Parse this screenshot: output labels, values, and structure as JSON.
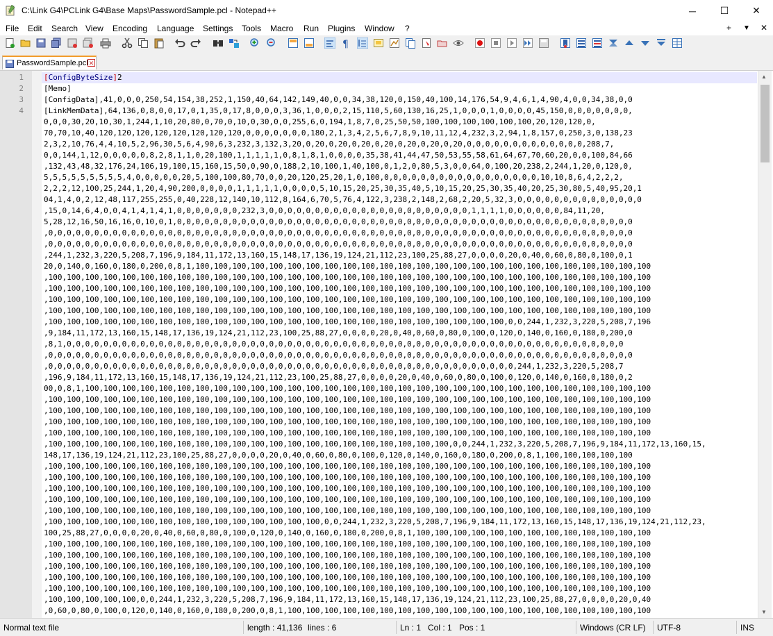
{
  "window": {
    "title": "C:\\Link G4\\PCLink G4\\Base Maps\\PasswordSample.pcl - Notepad++",
    "minimize": "─",
    "maximize": "☐",
    "close": "✕"
  },
  "menu": {
    "items": [
      "File",
      "Edit",
      "Search",
      "View",
      "Encoding",
      "Language",
      "Settings",
      "Tools",
      "Macro",
      "Run",
      "Plugins",
      "Window",
      "?"
    ],
    "right": [
      "+",
      "▼",
      "✕"
    ]
  },
  "toolbar": {
    "icons": [
      "new-file",
      "open-file",
      "save",
      "save-all",
      "close",
      "close-all",
      "print",
      "cut",
      "copy",
      "paste",
      "undo",
      "redo",
      "find",
      "replace",
      "zoom-in",
      "zoom-out",
      "sync-vertical",
      "sync-horizontal",
      "word-wrap",
      "show-all-chars",
      "indent-guide",
      "udl",
      "doc-map",
      "function-list",
      "folder-workspace",
      "monitoring",
      "start-recording",
      "stop-recording",
      "playback",
      "run-macro-multiple",
      "save-macro",
      "bookmark",
      "doc-list",
      "doc-switcher",
      "fold-all",
      "up",
      "down",
      "unfold",
      "panel"
    ]
  },
  "tab": {
    "label": "PasswordSample.pcl",
    "close": "✕"
  },
  "editor": {
    "line_numbers": [
      "1",
      "2",
      "3",
      "4"
    ],
    "lines": [
      {
        "bracket_open": "[",
        "section": "ConfigByteSize",
        "bracket_close": "]",
        "rest": "2"
      },
      {
        "bracket_open": "",
        "section": "",
        "bracket_close": "",
        "rest": "[Memo]"
      },
      {
        "bracket_open": "",
        "section": "",
        "bracket_close": "",
        "rest": "[ConfigData],41,0,0,0,250,54,154,38,252,1,150,40,64,142,149,40,0,0,34,38,120,0,150,40,100,14,176,54,9,4,6,1,4,90,4,0,0,34,38,0,0"
      }
    ],
    "wrap_lines": [
      "[LinkMemData],64,136,0,8,0,0,17,0,1,35,0,17,8,0,0,0,3,36,1,0,0,0,2,15,110,5,60,130,16,25,1,0,0,0,1,0,0,0,0,45,150,0,0,0,0,0,0,0,",
      "0,0,0,30,20,10,30,1,244,1,10,20,80,0,70,0,10,0,30,0,0,255,6,0,194,1,8,7,0,25,50,50,100,100,100,100,100,100,20,120,120,0,",
      "70,70,10,40,120,120,120,120,120,120,120,120,0,0,0,0,0,0,0,180,2,1,3,4,2,5,6,7,8,9,10,11,12,4,232,3,2,94,1,8,157,0,250,3,0,138,23",
      "2,3,2,10,76,4,4,10,5,2,96,30,5,6,4,90,6,3,232,3,132,3,20,0,20,0,20,0,20,0,20,0,20,0,20,0,20,0,0,0,0,0,0,0,0,0,0,0,0,0,208,7,",
      "0,0,144,1,12,0,0,0,0,0,8,2,8,1,1,0,20,100,1,1,1,1,1,0,8,1,8,1,0,0,0,0,35,38,41,44,47,50,53,55,58,61,64,67,70,60,20,0,0,100,84,66",
      ",132,43,48,32,176,24,106,19,100,15,160,15,50,0,90,0,188,2,10,100,1,40,100,0,1,2,0,80,5,3,0,0,64,0,100,20,238,2,244,1,20,0,120,0,",
      "5,5,5,5,5,5,5,5,5,4,0,0,0,0,0,20,5,100,100,80,70,0,0,20,120,25,20,1,0,100,0,0,0,0,0,0,0,0,0,0,0,0,0,0,0,0,0,10,10,8,6,4,2,2,2,",
      "2,2,2,12,100,25,244,1,20,4,90,200,0,0,0,0,1,1,1,1,1,0,0,0,0,5,10,15,20,25,30,35,40,5,10,15,20,25,30,35,40,20,25,30,80,5,40,95,20,1",
      "04,1,4,0,2,12,48,117,255,255,0,40,228,12,140,10,112,8,164,6,70,5,76,4,122,3,238,2,148,2,68,2,20,5,32,3,0,0,0,0,0,0,0,0,0,0,0,0,0,0",
      ",15,0,14,6,4,0,0,4,1,4,1,4,1,0,0,0,0,0,0,0,232,3,0,0,0,0,0,0,0,0,0,0,0,0,0,0,0,0,0,0,0,0,0,0,1,1,1,1,0,0,0,0,0,0,84,11,20,",
      "5,28,12,16,50,16,16,0,10,0,1,0,0,0,0,0,0,0,0,0,0,0,0,0,0,0,0,0,0,0,0,0,0,0,0,0,0,0,0,0,0,0,0,0,0,0,0,0,0,0,0,0,0,0,0,0,0,0,0,0,0",
      ",0,0,0,0,0,0,0,0,0,0,0,0,0,0,0,0,0,0,0,0,0,0,0,0,0,0,0,0,0,0,0,0,0,0,0,0,0,0,0,0,0,0,0,0,0,0,0,0,0,0,0,0,0,0,0,0,0,0,0,0,0,0,0,0",
      ",0,0,0,0,0,0,0,0,0,0,0,0,0,0,0,0,0,0,0,0,0,0,0,0,0,0,0,0,0,0,0,0,0,0,0,0,0,0,0,0,0,0,0,0,0,0,0,0,0,0,0,0,0,0,0,0,0,0,0,0,0,0,0,0",
      ",244,1,232,3,220,5,208,7,196,9,184,11,172,13,160,15,148,17,136,19,124,21,112,23,100,25,88,27,0,0,0,0,20,0,40,0,60,0,80,0,100,0,1",
      "20,0,140,0,160,0,180,0,200,0,8,1,100,100,100,100,100,100,100,100,100,100,100,100,100,100,100,100,100,100,100,100,100,100,100,100,100",
      ",100,100,100,100,100,100,100,100,100,100,100,100,100,100,100,100,100,100,100,100,100,100,100,100,100,100,100,100,100,100,100,100,100",
      ",100,100,100,100,100,100,100,100,100,100,100,100,100,100,100,100,100,100,100,100,100,100,100,100,100,100,100,100,100,100,100,100,100",
      ",100,100,100,100,100,100,100,100,100,100,100,100,100,100,100,100,100,100,100,100,100,100,100,100,100,100,100,100,100,100,100,100,100",
      ",100,100,100,100,100,100,100,100,100,100,100,100,100,100,100,100,100,100,100,100,100,100,100,100,100,100,100,100,100,100,100,100,100",
      ",100,100,100,100,100,100,100,100,100,100,100,100,100,100,100,100,100,100,100,100,100,100,100,100,100,0,0,244,1,232,3,220,5,208,7,196",
      ",9,184,11,172,13,160,15,148,17,136,19,124,21,112,23,100,25,88,27,0,0,0,0,20,0,40,0,60,0,80,0,100,0,120,0,140,0,160,0,180,0,200,0",
      ",8,1,0,0,0,0,0,0,0,0,0,0,0,0,0,0,0,0,0,0,0,0,0,0,0,0,0,0,0,0,0,0,0,0,0,0,0,0,0,0,0,0,0,0,0,0,0,0,0,0,0,0,0,0,0,0,0,0,0,0,0,0,0",
      ",0,0,0,0,0,0,0,0,0,0,0,0,0,0,0,0,0,0,0,0,0,0,0,0,0,0,0,0,0,0,0,0,0,0,0,0,0,0,0,0,0,0,0,0,0,0,0,0,0,0,0,0,0,0,0,0,0,0,0,0,0,0,0,0",
      ",0,0,0,0,0,0,0,0,0,0,0,0,0,0,0,0,0,0,0,0,0,0,0,0,0,0,0,0,0,0,0,0,0,0,0,0,0,0,0,0,0,0,0,0,0,0,0,0,0,0,0,244,1,232,3,220,5,208,7",
      ",196,9,184,11,172,13,160,15,148,17,136,19,124,21,112,23,100,25,88,27,0,0,0,0,20,0,40,0,60,0,80,0,100,0,120,0,140,0,160,0,180,0,2",
      "00,0,8,1,100,100,100,100,100,100,100,100,100,100,100,100,100,100,100,100,100,100,100,100,100,100,100,100,100,100,100,100,100,100,100",
      ",100,100,100,100,100,100,100,100,100,100,100,100,100,100,100,100,100,100,100,100,100,100,100,100,100,100,100,100,100,100,100,100,100",
      ",100,100,100,100,100,100,100,100,100,100,100,100,100,100,100,100,100,100,100,100,100,100,100,100,100,100,100,100,100,100,100,100,100",
      ",100,100,100,100,100,100,100,100,100,100,100,100,100,100,100,100,100,100,100,100,100,100,100,100,100,100,100,100,100,100,100,100,100",
      ",100,100,100,100,100,100,100,100,100,100,100,100,100,100,100,100,100,100,100,100,100,100,100,100,100,100,100,100,100,100,100,100,100",
      ",100,100,100,100,100,100,100,100,100,100,100,100,100,100,100,100,100,100,100,100,100,100,0,0,244,1,232,3,220,5,208,7,196,9,184,11,172,13,160,15,",
      "148,17,136,19,124,21,112,23,100,25,88,27,0,0,0,0,20,0,40,0,60,0,80,0,100,0,120,0,140,0,160,0,180,0,200,0,8,1,100,100,100,100,100",
      ",100,100,100,100,100,100,100,100,100,100,100,100,100,100,100,100,100,100,100,100,100,100,100,100,100,100,100,100,100,100,100,100,100",
      ",100,100,100,100,100,100,100,100,100,100,100,100,100,100,100,100,100,100,100,100,100,100,100,100,100,100,100,100,100,100,100,100,100",
      ",100,100,100,100,100,100,100,100,100,100,100,100,100,100,100,100,100,100,100,100,100,100,100,100,100,100,100,100,100,100,100,100,100",
      ",100,100,100,100,100,100,100,100,100,100,100,100,100,100,100,100,100,100,100,100,100,100,100,100,100,100,100,100,100,100,100,100,100",
      ",100,100,100,100,100,100,100,100,100,100,100,100,100,100,100,100,100,100,100,100,100,100,100,100,100,100,100,100,100,100,100,100,100",
      ",100,100,100,100,100,100,100,100,100,100,100,100,100,100,100,0,0,244,1,232,3,220,5,208,7,196,9,184,11,172,13,160,15,148,17,136,19,124,21,112,23,",
      "100,25,88,27,0,0,0,0,20,0,40,0,60,0,80,0,100,0,120,0,140,0,160,0,180,0,200,0,8,1,100,100,100,100,100,100,100,100,100,100,100,100,100",
      ",100,100,100,100,100,100,100,100,100,100,100,100,100,100,100,100,100,100,100,100,100,100,100,100,100,100,100,100,100,100,100,100,100",
      ",100,100,100,100,100,100,100,100,100,100,100,100,100,100,100,100,100,100,100,100,100,100,100,100,100,100,100,100,100,100,100,100,100",
      ",100,100,100,100,100,100,100,100,100,100,100,100,100,100,100,100,100,100,100,100,100,100,100,100,100,100,100,100,100,100,100,100,100",
      ",100,100,100,100,100,100,100,100,100,100,100,100,100,100,100,100,100,100,100,100,100,100,100,100,100,100,100,100,100,100,100,100,100",
      ",100,100,100,100,100,100,100,100,100,100,100,100,100,100,100,100,100,100,100,100,100,100,100,100,100,100,100,100,100,100,100,100,100",
      ",100,100,100,100,100,0,0,244,1,232,3,220,5,208,7,196,9,184,11,172,13,160,15,148,17,136,19,124,21,112,23,100,25,88,27,0,0,0,0,20,0,40",
      ",0,60,0,80,0,100,0,120,0,140,0,160,0,180,0,200,0,8,1,100,100,100,100,100,100,100,100,100,100,100,100,100,100,100,100,100,100,100,100"
    ]
  },
  "status": {
    "file_type": "Normal text file",
    "length": "length : 41,136",
    "lines": "lines : 6",
    "ln": "Ln : 1",
    "col": "Col : 1",
    "pos": "Pos : 1",
    "eol": "Windows (CR LF)",
    "encoding": "UTF-8",
    "insert": "INS"
  }
}
